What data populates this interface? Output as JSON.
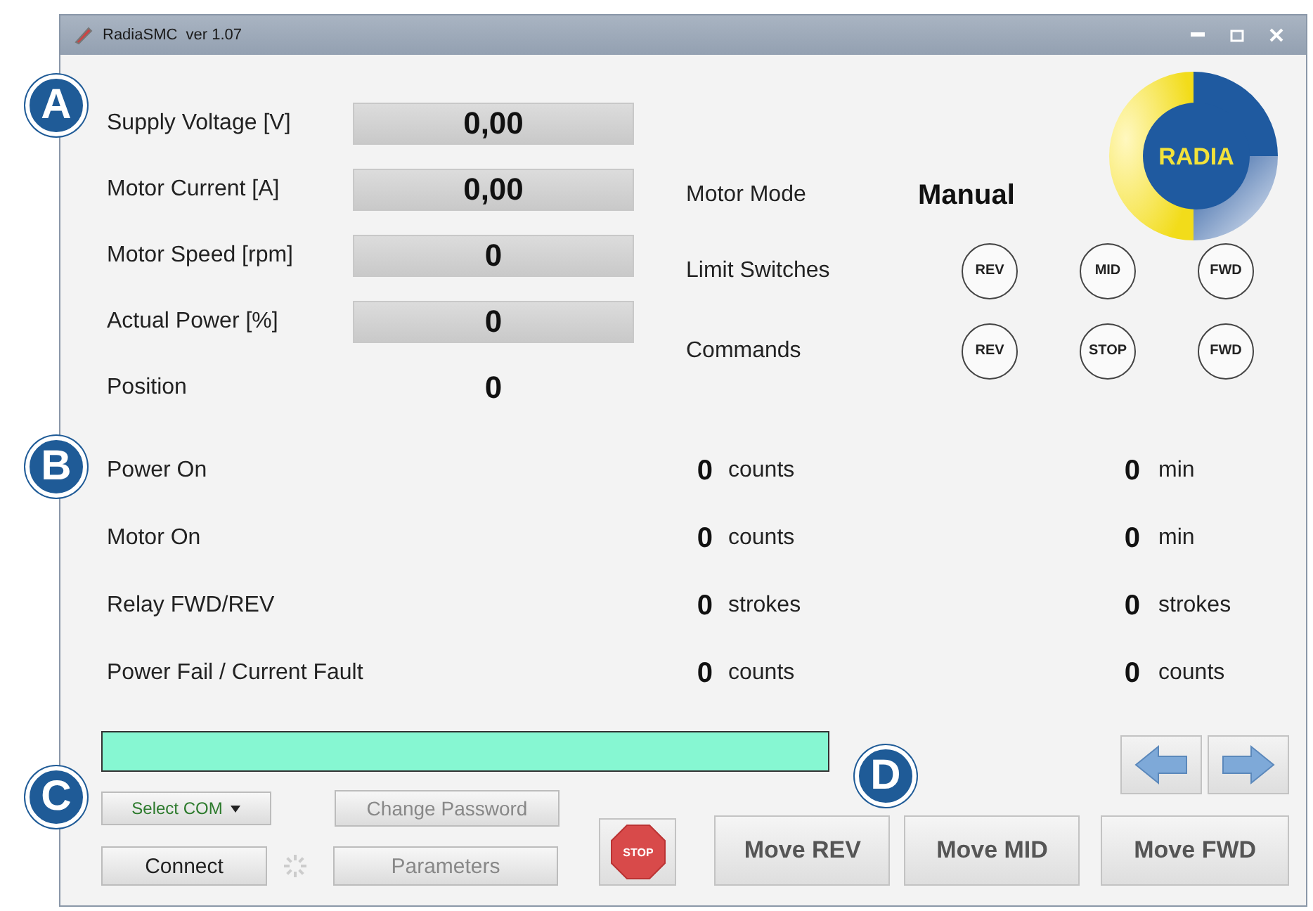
{
  "window": {
    "title": "RadiaSMC  ver 1.07"
  },
  "callouts": [
    "A",
    "B",
    "C",
    "D"
  ],
  "readings": [
    {
      "label": "Supply Voltage [V]",
      "value": "0,00",
      "kind": "box"
    },
    {
      "label": "Motor Current [A]",
      "value": "0,00",
      "kind": "box"
    },
    {
      "label": "Motor Speed [rpm]",
      "value": "0",
      "kind": "box"
    },
    {
      "label": "Actual Power [%]",
      "value": "0",
      "kind": "box"
    },
    {
      "label": "Position",
      "value": "0",
      "kind": "plain"
    }
  ],
  "logo": {
    "text": "RADIA"
  },
  "motor_mode": {
    "label": "Motor Mode",
    "value": "Manual"
  },
  "limit_switches": {
    "label": "Limit Switches",
    "indicators": [
      "REV",
      "MID",
      "FWD"
    ]
  },
  "commands": {
    "label": "Commands",
    "indicators": [
      "REV",
      "STOP",
      "FWD"
    ]
  },
  "counters": [
    {
      "label": "Power On",
      "count": "0",
      "count_unit": "counts",
      "total": "0",
      "total_unit": "min"
    },
    {
      "label": "Motor On",
      "count": "0",
      "count_unit": "counts",
      "total": "0",
      "total_unit": "min"
    },
    {
      "label": "Relay FWD/REV",
      "count": "0",
      "count_unit": "strokes",
      "total": "0",
      "total_unit": "strokes"
    },
    {
      "label": "Power Fail / Current Fault",
      "count": "0",
      "count_unit": "counts",
      "total": "0",
      "total_unit": "counts"
    }
  ],
  "com_select": {
    "value": "Select COM"
  },
  "connect_button": {
    "label": "Connect",
    "disabled": false
  },
  "change_password_button": {
    "label": "Change Password",
    "disabled": true
  },
  "parameters_button": {
    "label": "Parameters",
    "disabled": true
  },
  "stop_button": {
    "label": "STOP"
  },
  "move_buttons": [
    "Move REV",
    "Move MID",
    "Move FWD"
  ]
}
